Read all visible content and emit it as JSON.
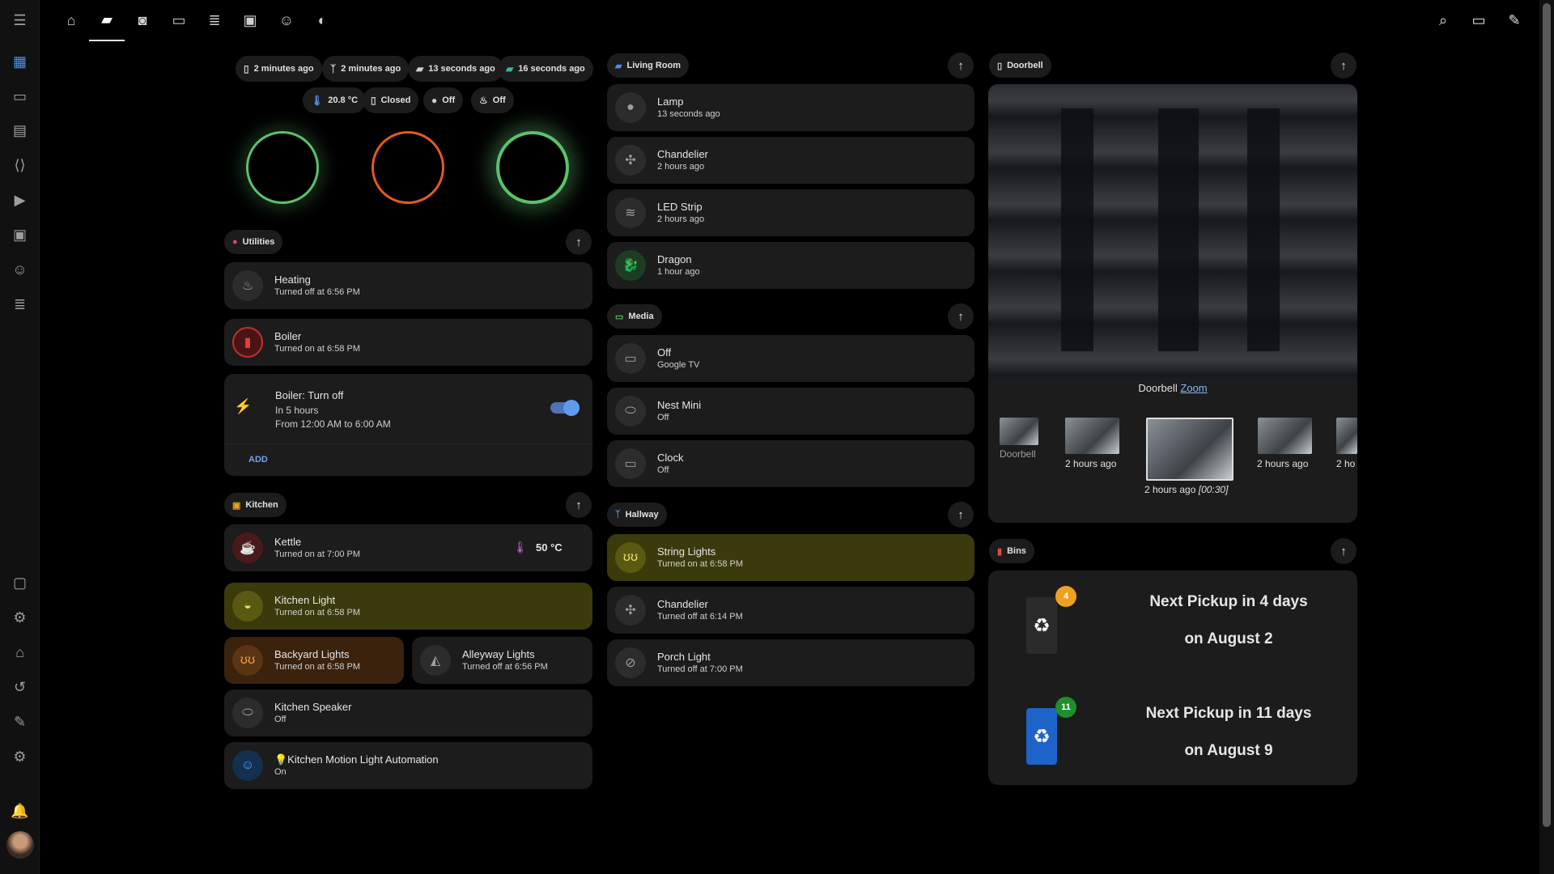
{
  "colors": {
    "accent": "#4f8fe6",
    "on_yellow": "#3b3a0c",
    "green_ring": "#5ec16c",
    "orange_ring": "#e35a22"
  },
  "sidebar": {
    "items": [
      "menu-icon",
      "overview-icon",
      "map-icon",
      "logbook-icon",
      "code-icon",
      "media-icon",
      "calendar-icon",
      "robot-icon",
      "storage-icon",
      "vscode-icon",
      "settings-cog-icon",
      "hacs-icon",
      "backup-icon",
      "developer-tools-icon",
      "settings-icon",
      "notifications-icon",
      "avatar"
    ]
  },
  "tabs": [
    "factory-icon",
    "sofa-icon",
    "washer-icon",
    "monitor-icon",
    "server-icon",
    "cast-icon",
    "robot-icon",
    "pacman-icon"
  ],
  "header_actions": [
    "search-icon",
    "assist-icon",
    "edit-icon"
  ],
  "summary": {
    "chips_row1": [
      "2 minutes ago",
      "2 minutes ago",
      "13 seconds ago",
      "16 seconds ago"
    ],
    "chips_row2": [
      "20.8 °C",
      "Closed",
      "Off",
      "Off"
    ]
  },
  "utilities": {
    "title": "Utilities",
    "heating": {
      "name": "Heating",
      "state": "Turned off at 6:56 PM"
    },
    "boiler": {
      "name": "Boiler",
      "state": "Turned on at 6:58 PM"
    },
    "schedule": {
      "name": "Boiler: Turn off",
      "when": "In 5 hours",
      "range": "From 12:00 AM to 6:00 AM",
      "add": "ADD"
    }
  },
  "kitchen": {
    "title": "Kitchen",
    "kettle": {
      "name": "Kettle",
      "state": "Turned on at 7:00 PM",
      "temp": "50 °C"
    },
    "light": {
      "name": "Kitchen Light",
      "state": "Turned on at 6:58 PM"
    },
    "backyard": {
      "name": "Backyard Lights",
      "state": "Turned on at 6:58 PM"
    },
    "alleyway": {
      "name": "Alleyway Lights",
      "state": "Turned off at 6:56 PM"
    },
    "speaker": {
      "name": "Kitchen Speaker",
      "state": "Off"
    },
    "motion": {
      "name": "💡Kitchen Motion Light Automation",
      "state": "On"
    }
  },
  "living": {
    "title": "Living Room",
    "items": [
      {
        "name": "Lamp",
        "state": "13 seconds ago"
      },
      {
        "name": "Chandelier",
        "state": "2 hours ago"
      },
      {
        "name": "LED Strip",
        "state": "2 hours ago"
      },
      {
        "name": "Dragon",
        "state": "1 hour ago"
      }
    ]
  },
  "media": {
    "title": "Media",
    "items": [
      {
        "name": "Off",
        "state": "Google TV"
      },
      {
        "name": "Nest Mini",
        "state": "Off"
      },
      {
        "name": "Clock",
        "state": "Off"
      }
    ]
  },
  "hallway": {
    "title": "Hallway",
    "items": [
      {
        "name": "String Lights",
        "state": "Turned on at 6:58 PM"
      },
      {
        "name": "Chandelier",
        "state": "Turned off at 6:14 PM"
      },
      {
        "name": "Porch Light",
        "state": "Turned off at 7:00 PM"
      }
    ]
  },
  "doorbell": {
    "title": "Doorbell",
    "caption": "Doorbell",
    "zoom": "Zoom",
    "thumbs": [
      "Doorbell",
      "2 hours ago",
      "2 hours ago",
      "2 hours ago",
      "2 ho"
    ],
    "thumb_duration": "[00:30]"
  },
  "bins": {
    "title": "Bins",
    "bin1": {
      "badge": "4",
      "line1": "Next Pickup in 4 days",
      "line2": "on August 2",
      "color": "#2b2b2b",
      "badge_color": "#f0a020"
    },
    "bin2": {
      "badge": "11",
      "line1": "Next Pickup in 11 days",
      "line2": "on August 9",
      "color": "#1e63c8",
      "badge_color": "#1e8f2a"
    }
  }
}
